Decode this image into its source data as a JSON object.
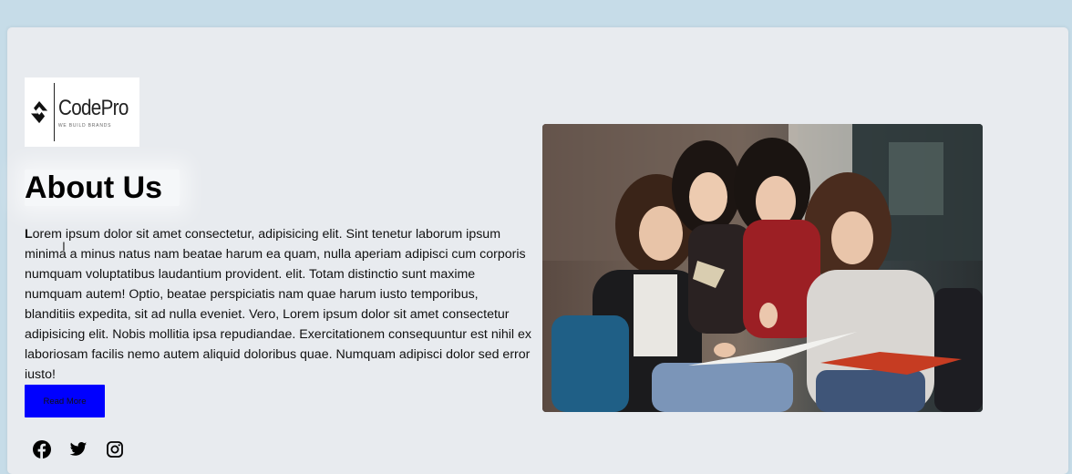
{
  "logo": {
    "brand": "CodePro",
    "tagline": "WE BUILD BRANDS"
  },
  "about": {
    "heading": "About Us",
    "first_letter": "L",
    "paragraph": "orem ipsum dolor sit amet consectetur, adipisicing elit. Sint tenetur laborum ipsum minima a minus natus nam beatae harum ea quam, nulla aperiam adipisci cum corporis numquam voluptatibus laudantium provident. elit. Totam distinctio sunt maxime numquam autem! Optio, beatae perspiciatis nam quae harum iusto temporibus, blanditiis expedita, sit ad nulla eveniet. Vero, Lorem ipsum dolor sit amet consectetur adipisicing elit. Nobis mollitia ipsa repudiandae. Exercitationem consequuntur est nihil ex laboriosam facilis nemo autem aliquid doloribus quae. Numquam adipisci dolor sed error iusto!",
    "button_label": "Read More"
  },
  "social_icons": [
    "facebook-icon",
    "twitter-icon",
    "instagram-icon"
  ],
  "colors": {
    "page_background": "#c6dce8",
    "card_background": "#e8ebef",
    "button_background": "#0000ff"
  }
}
